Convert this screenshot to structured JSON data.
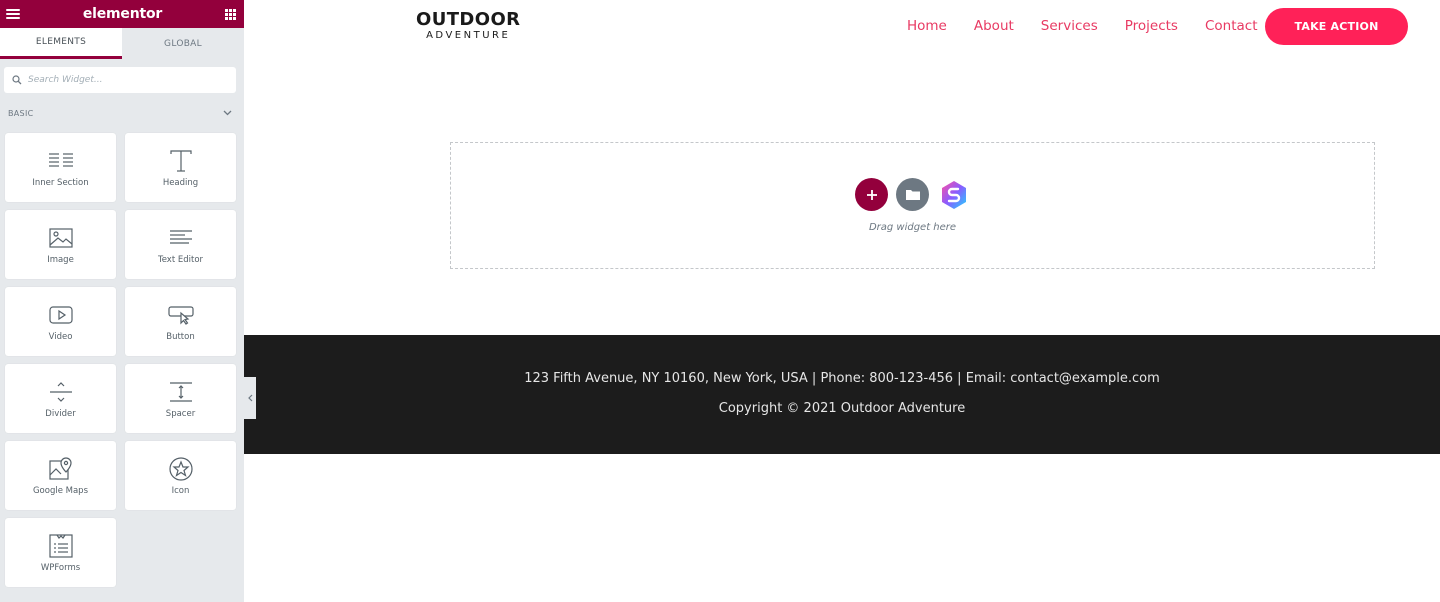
{
  "sidebar": {
    "brand": "elementor",
    "tabs": [
      {
        "label": "ELEMENTS"
      },
      {
        "label": "GLOBAL"
      }
    ],
    "search_placeholder": "Search Widget...",
    "category": "BASIC",
    "widgets": [
      {
        "label": "Inner Section",
        "icon": "inner-section-icon"
      },
      {
        "label": "Heading",
        "icon": "heading-icon"
      },
      {
        "label": "Image",
        "icon": "image-icon"
      },
      {
        "label": "Text Editor",
        "icon": "text-editor-icon"
      },
      {
        "label": "Video",
        "icon": "video-icon"
      },
      {
        "label": "Button",
        "icon": "button-icon"
      },
      {
        "label": "Divider",
        "icon": "divider-icon"
      },
      {
        "label": "Spacer",
        "icon": "spacer-icon"
      },
      {
        "label": "Google Maps",
        "icon": "google-maps-icon"
      },
      {
        "label": "Icon",
        "icon": "star-icon"
      },
      {
        "label": "WPForms",
        "icon": "wpforms-icon"
      }
    ]
  },
  "site": {
    "logo_line1": "OUTDOOR",
    "logo_line2": "ADVENTURE",
    "nav": [
      {
        "label": "Home"
      },
      {
        "label": "About"
      },
      {
        "label": "Services"
      },
      {
        "label": "Projects"
      },
      {
        "label": "Contact"
      }
    ],
    "cta": "TAKE ACTION",
    "dropzone_text": "Drag widget here",
    "footer_line1": "123 Fifth Avenue, NY 10160, New York, USA | Phone: 800-123-456 | Email: contact@example.com",
    "footer_line2": "Copyright © 2021 Outdoor Adventure"
  },
  "colors": {
    "brand": "#93003c",
    "nav_link": "#e83a63",
    "cta": "#ff2158",
    "footer_bg": "#1c1c1c"
  }
}
